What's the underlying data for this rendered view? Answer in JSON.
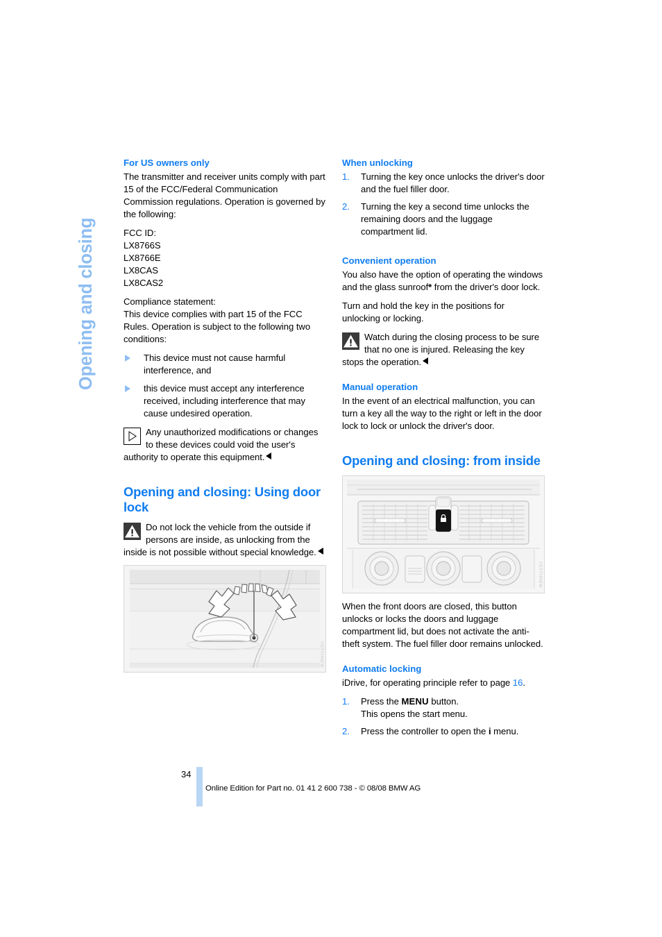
{
  "chapter": {
    "title": "Opening and closing"
  },
  "left_column": {
    "heading_us": "For US owners only",
    "para_transmitter": "The transmitter and receiver units comply with part 15 of the FCC/Federal Communication Commission regulations. Operation is governed by the following:",
    "fcc_label": "FCC ID:",
    "fcc_ids": [
      "LX8766S",
      "LX8766E",
      "LX8CAS",
      "LX8CAS2"
    ],
    "compliance_label": "Compliance statement:",
    "compliance_text": "This device complies with part 15 of the FCC Rules. Operation is subject to the following two conditions:",
    "conditions": [
      "This device must not cause harmful interference, and",
      "this device must accept any interference received, including interference that may cause undesired operation."
    ],
    "hint_note": "Any unauthorized modifications or changes to these devices could void the user's authority to operate this equipment.",
    "heading_doorlock": "Opening and closing: Using door lock",
    "warning_doorlock": "Do not lock the vehicle from the outside if persons are inside, as unlocking from the inside is not possible without special knowledge.",
    "figure_doorlock_code": "VERTHNEW"
  },
  "right_column": {
    "heading_unlocking": "When unlocking",
    "unlocking_steps": [
      "Turning the key once unlocks the driver's door and the fuel filler door.",
      "Turning the key a second time unlocks the remaining doors and the luggage compartment lid."
    ],
    "heading_convenient": "Convenient operation",
    "para_convenient_1": "You also have the option of operating the windows and the glass sunroof",
    "para_convenient_1_end": " from the driver's door lock.",
    "para_convenient_2": "Turn and hold the key in the positions for unlocking or locking.",
    "warning_closing": "Watch during the closing process to be sure that no one is injured. Releasing the key stops the operation.",
    "heading_manual": "Manual operation",
    "para_manual": "In the event of an electrical malfunction, you can turn a key all the way to the right or left in the door lock to lock or unlock the driver's door.",
    "heading_inside": "Opening and closing: from inside",
    "figure_inside_code": "VERTHNEW",
    "para_inside": "When the front doors are closed, this button unlocks or locks the doors and luggage compartment lid, but does not activate the anti-theft system. The fuel filler door remains unlocked.",
    "heading_autolock": "Automatic locking",
    "para_idrive_pre": "iDrive, for operating principle refer to page ",
    "para_idrive_ref": "16",
    "para_idrive_post": ".",
    "autolock_step1_a": "Press the ",
    "autolock_step1_kbd": "MENU",
    "autolock_step1_b": " button.",
    "autolock_step1_c": "This opens the start menu.",
    "autolock_step2_a": "Press the controller to open the ",
    "autolock_step2_icon": "i",
    "autolock_step2_b": " menu."
  },
  "footer": {
    "page_number": "34",
    "edition_line": "Online Edition for Part no. 01 41 2 600 738 - © 08/08 BMW AG"
  },
  "colors": {
    "heading_blue": "#0f7cf0",
    "chapter_blue": "#8ebdf2",
    "page_bar_blue": "#b9d6f5"
  }
}
